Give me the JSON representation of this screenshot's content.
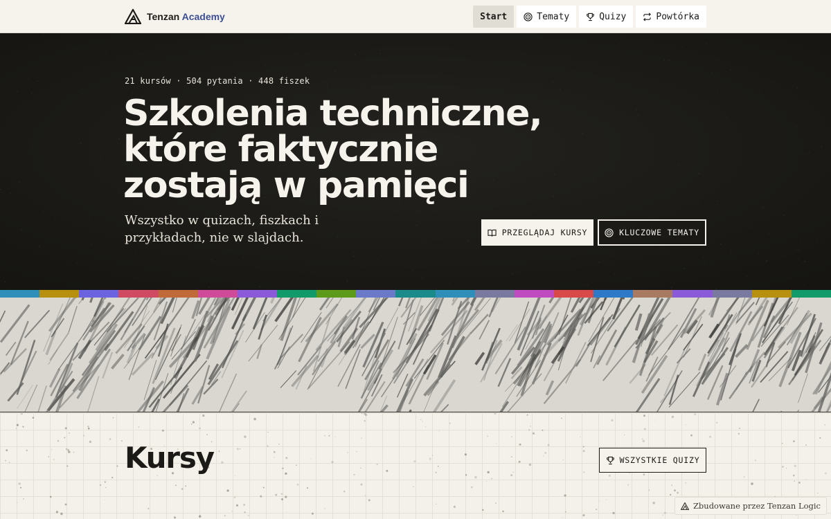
{
  "header": {
    "brand_main": "Tenzan",
    "brand_accent": "Academy",
    "logo_icon": "tenzan-mountain-logo",
    "nav": [
      {
        "label": "Start",
        "icon": "",
        "active": true
      },
      {
        "label": "Tematy",
        "icon": "target-icon"
      },
      {
        "label": "Quizy",
        "icon": "trophy-icon"
      },
      {
        "label": "Powtórka",
        "icon": "repeat-icon"
      }
    ]
  },
  "hero": {
    "stats": "21 kursów · 504 pytania · 448 fiszek",
    "title_line1": "Szkolenia techniczne,",
    "title_line2": "które faktycznie",
    "title_line3": "zostają w pamięci",
    "subtitle": "Wszystko w quizach, fiszkach i przykładach, nie w slajdach.",
    "primary_button": "PRZEGLĄDAJ KURSY",
    "secondary_button": "KLUCZOWE TEMATY"
  },
  "strip_colors": [
    "#2f8fb8",
    "#b8900f",
    "#6b63e0",
    "#d04a64",
    "#c06a3a",
    "#d04a9a",
    "#8a5ad8",
    "#119a6a",
    "#5e9a1a",
    "#6a7ac8",
    "#1a8a8a",
    "#2f8fb8",
    "#7a7aa0",
    "#c04ac0",
    "#d84a4a",
    "#2f7ac8",
    "#a87a62",
    "#8a5ad8",
    "#7a7aa0",
    "#b8900f",
    "#119a6a"
  ],
  "courses": {
    "title": "Kursy",
    "all_quizzes_button": "WSZYSTKIE QUIZY"
  },
  "footer_badge": "Zbudowane przez Tenzan Logic",
  "colors": {
    "dark": "#1b1a17",
    "cream": "#f6f3ec",
    "brand_accent": "#3c4f94"
  }
}
